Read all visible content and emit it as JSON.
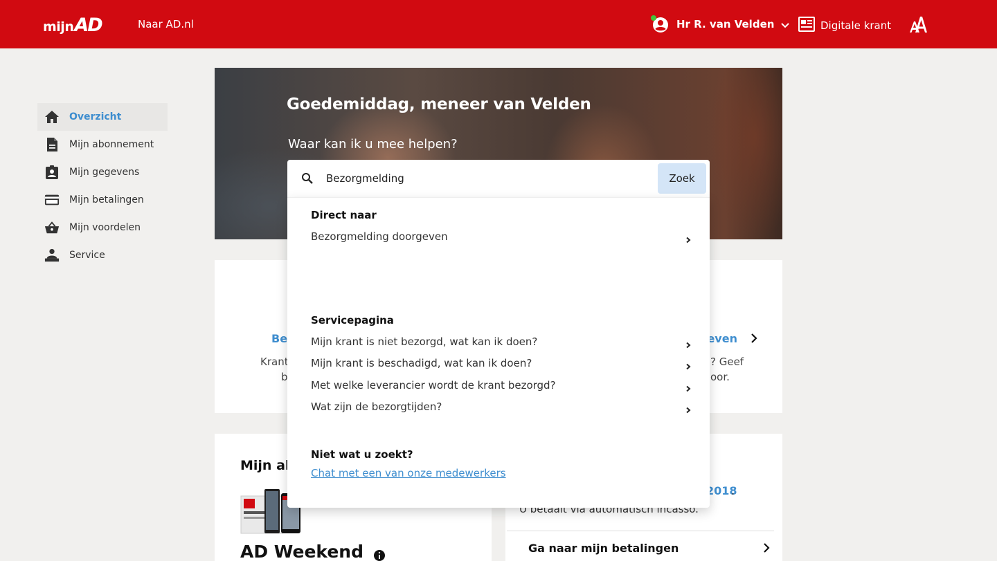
{
  "header": {
    "logo_mijn": "mijn",
    "logo_ad": "AD",
    "naar_link": "Naar AD.nl",
    "user_name": "Hr R. van Velden",
    "digital_label": "Digitale krant"
  },
  "sidebar": {
    "items": [
      {
        "label": "Overzicht",
        "icon": "home-icon",
        "active": true
      },
      {
        "label": "Mijn abonnement",
        "icon": "document-icon"
      },
      {
        "label": "Mijn gegevens",
        "icon": "contact-badge-icon"
      },
      {
        "label": "Mijn betalingen",
        "icon": "credit-card-icon"
      },
      {
        "label": "Mijn voordelen",
        "icon": "basket-icon"
      },
      {
        "label": "Service",
        "icon": "service-desk-icon"
      }
    ]
  },
  "hero": {
    "title": "Goedemiddag, meneer van Velden",
    "subtitle": "Waar kan ik u mee helpen?"
  },
  "search": {
    "value": "Bezorgmelding",
    "button": "Zoek"
  },
  "dropdown": {
    "direct_heading": "Direct naar",
    "direct_items": [
      "Bezorgmelding doorgeven"
    ],
    "service_heading": "Servicepagina",
    "service_items": [
      "Mijn krant is niet bezorgd, wat kan ik doen?",
      "Mijn krant is beschadigd, wat kan ik doen?",
      "Met welke leverancier wordt de krant bezorgd?",
      "Wat zijn de bezorgtijden?"
    ],
    "not_found_heading": "Niet wat u zoekt?",
    "chat_link": "Chat met een van onze medewerkers"
  },
  "cards": {
    "left_link_fragment": "Bez",
    "left_text_1": "Krant",
    "left_text_2": "b",
    "right_link_fragment": "geven",
    "right_text_1": "? Geef",
    "right_text_2": "oor.",
    "subscription_heading_fragment": "Mijn ab",
    "subscription_name": "AD Weekend",
    "year_fragment": "2018",
    "year_dot": ".",
    "incasso_text": "U betaalt via automatisch incasso.",
    "goto_payments": "Ga naar mijn betalingen"
  },
  "colors": {
    "brand_red": "#d10a11",
    "link_blue": "#3f8ecf",
    "button_blue": "#d4e5f7",
    "online_green": "#43c43a"
  }
}
